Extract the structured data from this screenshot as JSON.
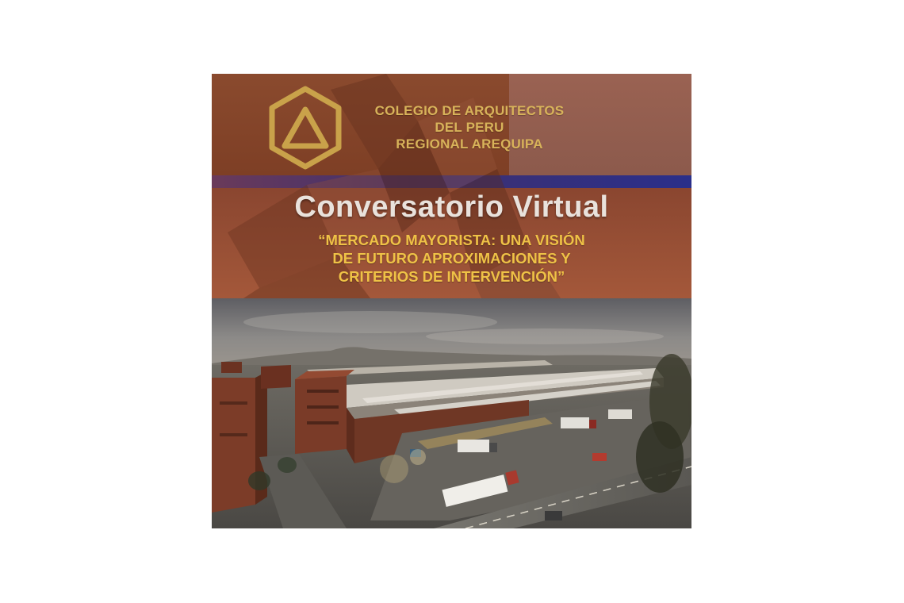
{
  "institution": {
    "line1": "COLEGIO DE ARQUITECTOS",
    "line2": "DEL PERU",
    "line3": "REGIONAL AREQUIPA"
  },
  "event": {
    "title": "Conversatorio Virtual",
    "subtitle_line1": "“MERCADO MAYORISTA: UNA VISIÓN",
    "subtitle_line2": "DE FUTURO APROXIMACIONES Y",
    "subtitle_line3": "CRITERIOS DE INTERVENCIÓN”"
  },
  "colors": {
    "gold": "#d8b35a",
    "subtitle_yellow": "#efc246",
    "header_brown": "#7e3f25",
    "band_blue": "#2a2f8a"
  },
  "icons": {
    "logo": "hexagon-triangle-logo-icon"
  }
}
